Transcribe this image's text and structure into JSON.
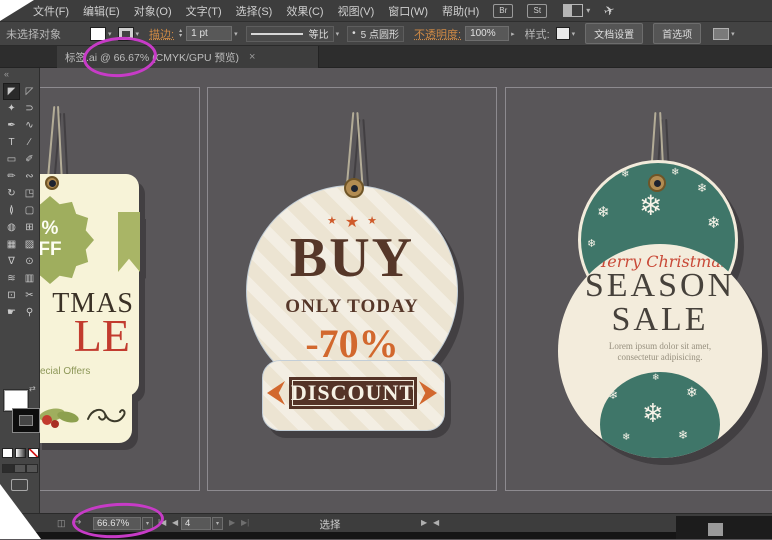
{
  "menubar": {
    "items": [
      "文件(F)",
      "编辑(E)",
      "对象(O)",
      "文字(T)",
      "选择(S)",
      "效果(C)",
      "视图(V)",
      "窗口(W)",
      "帮助(H)"
    ],
    "bridge_label": "Br",
    "stock_label": "St"
  },
  "control_bar": {
    "status": "未选择对象",
    "stroke_label": "描边:",
    "stroke_width": "1 pt",
    "profile": "等比",
    "brush_bullet": "•",
    "brush": "5 点圆形",
    "opacity_label": "不透明度:",
    "opacity_value": "100%",
    "style_label": "样式:",
    "doc_setup_label": "文档设置",
    "preferences_label": "首选项"
  },
  "tab_bar": {
    "active_tab": "标签.ai @ 66.67% (CMYK/GPU 预览)",
    "close": "×"
  },
  "toolbar": {
    "collapse": "«",
    "swap": "⇄",
    "glyphs": [
      "◤",
      "◸",
      "✦",
      "⊃",
      "✒",
      "∿",
      "T",
      "∕",
      "▭",
      "✐",
      "✏",
      "∾",
      "↻",
      "◳",
      "≬",
      "▢",
      "◍",
      "⊞",
      "▦",
      "▨",
      "∇",
      "⊙",
      "≋",
      "▥",
      "⊡",
      "✂",
      "☛",
      "⚲"
    ]
  },
  "icons": {
    "dropdown": "▾",
    "step_up": "▴",
    "step_down": "▾",
    "share": "✈",
    "status_artboard": "◫",
    "status_arrow": "↪",
    "nav_first": "|◀",
    "nav_prev": "◀",
    "nav_next": "▶",
    "nav_last": "▶|",
    "scroll_left": "◀",
    "scroll_right": "▶",
    "opacity_expand": "▸"
  },
  "canvas": {
    "left_tag": {
      "badge_line1": "%",
      "badge_line2": "FF",
      "title_fragment": "TMAS",
      "sale_fragment": "LE",
      "offers_fragment": "ecial Offers"
    },
    "center_tag": {
      "star": "★",
      "line1": "BUY",
      "line2": "ONLY TODAY",
      "discount": "-70%",
      "button_label": "DISCOUNT"
    },
    "right_tag": {
      "script": "Merry Christmas",
      "title1": "SEASON",
      "title2": "SALE",
      "body1": "Lorem ipsum dolor sit amet,",
      "body2": "consectetur adipisicing.",
      "snowflake": "❄"
    }
  },
  "status_bar": {
    "zoom": "66.67%",
    "artboard_number": "4",
    "tool_name": "选择"
  },
  "colors": {
    "annotation": "#c73bc7",
    "canvas_bg": "#595659",
    "tag_cream": "#ece4d2",
    "tag_brown": "#563729",
    "tag_orange": "#d2682e",
    "tag_teal": "#3f7669",
    "tag_green": "#9fae5e",
    "tag_red": "#c23b2e"
  }
}
